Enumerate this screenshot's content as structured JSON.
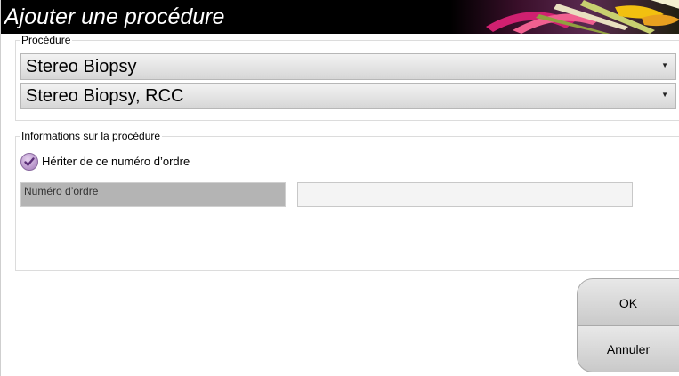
{
  "dialog": {
    "title": "Ajouter une procédure"
  },
  "procedure_group": {
    "legend": "Procédure",
    "procedure_select": {
      "value": "Stereo Biopsy",
      "icon": "dropdown-arrow-icon"
    },
    "view_select": {
      "value": "Stereo Biopsy, RCC",
      "icon": "dropdown-arrow-icon"
    }
  },
  "info_group": {
    "legend": "Informations sur la procédure",
    "inherit_checkbox": {
      "label": "Hériter de ce numéro d’ordre",
      "checked": true,
      "icon": "checkmark-icon",
      "color": "#a57fbd"
    },
    "accession": {
      "label": "Numéro d’ordre",
      "value": ""
    }
  },
  "buttons": {
    "ok_label": "OK",
    "cancel_label": "Annuler"
  }
}
